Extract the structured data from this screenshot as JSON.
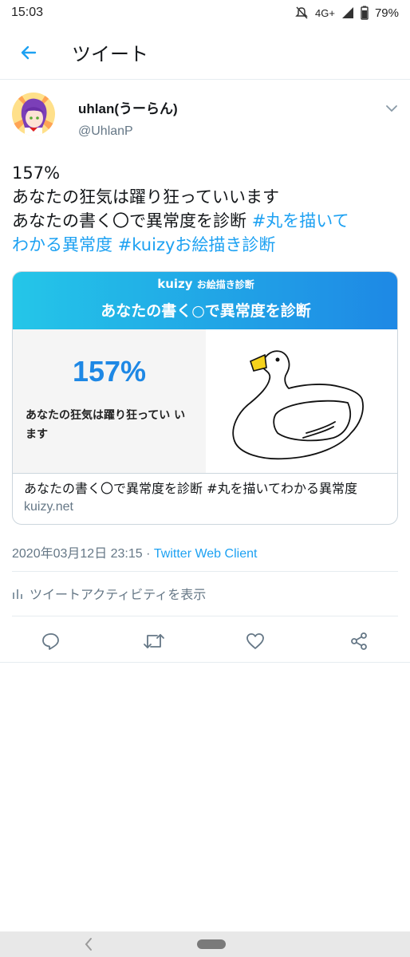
{
  "status_bar": {
    "time": "15:03",
    "network": "4G+",
    "battery": "79%"
  },
  "header": {
    "title": "ツイート"
  },
  "tweet": {
    "user_name": "uhlan(うーらん)",
    "handle": "@UhlanP",
    "text_lines": [
      "157%",
      "あなたの狂気は躍り狂っていいます",
      "あなたの書く〇で異常度を診断 "
    ],
    "hashtag1": "#丸を描いて",
    "hashtag1_cont": "わかる異常度",
    "hashtag2": "#kuizyお絵描き診断",
    "timestamp": "2020年03月12日 23:15 · ",
    "client": "Twitter Web Client",
    "activity": "ツイートアクティビティを表示"
  },
  "card": {
    "brand": "kuizy",
    "brand_sub": "お絵描き診断",
    "banner_title": "あなたの書く○で異常度を診断",
    "percent": "157%",
    "result_text": "あなたの狂気は躍り狂ってい います",
    "meta_title": "あなたの書く〇で異常度を診断 #丸を描いてわかる異常度",
    "domain": "kuizy.net"
  },
  "colors": {
    "accent": "#1da1f2",
    "card_gradient_start": "#24c6e8",
    "card_gradient_end": "#1e88e5",
    "percent": "#1e88e5",
    "secondary_text": "#657786"
  }
}
